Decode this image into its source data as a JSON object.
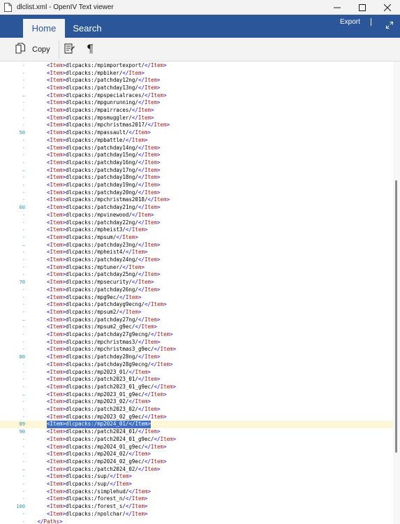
{
  "window": {
    "title": "dlclist.xml - OpenIV Text viewer"
  },
  "ribbon": {
    "tabs": [
      {
        "label": "Home"
      },
      {
        "label": "Search"
      }
    ],
    "export_label": "Export"
  },
  "toolbar": {
    "copy_label": "Copy"
  },
  "icons": {
    "app": "document-icon",
    "minimize": "minimize-icon",
    "maximize": "maximize-icon",
    "close": "close-icon",
    "expand": "expand-icon",
    "copy": "copy-icon",
    "word_wrap": "word-wrap-icon",
    "show_symbols": "pilcrow-icon"
  },
  "colors": {
    "accent": "#2b579a",
    "tag": "#0000ff",
    "tag_name": "#a31515",
    "line_number": "#2b91af",
    "selection": "#3e6fc5",
    "current_line": "#fdf7d8"
  },
  "editor": {
    "highlighted_line": "89",
    "scroll_fraction": 0.55,
    "lines": [
      {
        "num": "·",
        "indent": "      ",
        "open": "Item",
        "text": "dlcpacks:/mpimportexport/",
        "close": "Item"
      },
      {
        "num": "·",
        "indent": "      ",
        "open": "Item",
        "text": "dlcpacks:/mpbiker/",
        "close": "Item"
      },
      {
        "num": "·",
        "indent": "      ",
        "open": "Item",
        "text": "dlcpacks:/patchday12ng/",
        "close": "Item"
      },
      {
        "num": "·",
        "indent": "      ",
        "open": "Item",
        "text": "dlcpacks:/patchday13ng/",
        "close": "Item"
      },
      {
        "num": "–",
        "indent": "      ",
        "open": "Item",
        "text": "dlcpacks:/mpspecialraces/",
        "close": "Item"
      },
      {
        "num": "·",
        "indent": "      ",
        "open": "Item",
        "text": "dlcpacks:/mpgunrunning/",
        "close": "Item"
      },
      {
        "num": "·",
        "indent": "      ",
        "open": "Item",
        "text": "dlcpacks:/mpairraces/",
        "close": "Item"
      },
      {
        "num": "·",
        "indent": "      ",
        "open": "Item",
        "text": "dlcpacks:/mpsmuggler/",
        "close": "Item"
      },
      {
        "num": "·",
        "indent": "      ",
        "open": "Item",
        "text": "dlcpacks:/mpchristmas2017/",
        "close": "Item"
      },
      {
        "num": "50",
        "indent": "      ",
        "open": "Item",
        "text": "dlcpacks:/mpassault/",
        "close": "Item"
      },
      {
        "num": "·",
        "indent": "      ",
        "open": "Item",
        "text": "dlcpacks:/mpbattle/",
        "close": "Item"
      },
      {
        "num": "·",
        "indent": "      ",
        "open": "Item",
        "text": "dlcpacks:/patchday14ng/",
        "close": "Item"
      },
      {
        "num": "·",
        "indent": "      ",
        "open": "Item",
        "text": "dlcpacks:/patchday15ng/",
        "close": "Item"
      },
      {
        "num": "·",
        "indent": "      ",
        "open": "Item",
        "text": "dlcpacks:/patchday16ng/",
        "close": "Item"
      },
      {
        "num": "–",
        "indent": "      ",
        "open": "Item",
        "text": "dlcpacks:/patchday17ng/",
        "close": "Item"
      },
      {
        "num": "·",
        "indent": "      ",
        "open": "Item",
        "text": "dlcpacks:/patchday18ng/",
        "close": "Item"
      },
      {
        "num": "·",
        "indent": "      ",
        "open": "Item",
        "text": "dlcpacks:/patchday19ng/",
        "close": "Item"
      },
      {
        "num": "·",
        "indent": "      ",
        "open": "Item",
        "text": "dlcpacks:/patchday20ng/",
        "close": "Item"
      },
      {
        "num": "·",
        "indent": "      ",
        "open": "Item",
        "text": "dlcpacks:/mpchristmas2018/",
        "close": "Item"
      },
      {
        "num": "60",
        "indent": "      ",
        "open": "Item",
        "text": "dlcpacks:/patchday21ng/",
        "close": "Item"
      },
      {
        "num": "·",
        "indent": "      ",
        "open": "Item",
        "text": "dlcpacks:/mpvinewood/",
        "close": "Item"
      },
      {
        "num": "·",
        "indent": "      ",
        "open": "Item",
        "text": "dlcpacks:/patchday22ng/",
        "close": "Item"
      },
      {
        "num": "·",
        "indent": "      ",
        "open": "Item",
        "text": "dlcpacks:/mpheist3/",
        "close": "Item"
      },
      {
        "num": "·",
        "indent": "      ",
        "open": "Item",
        "text": "dlcpacks:/mpsum/",
        "close": "Item"
      },
      {
        "num": "–",
        "indent": "      ",
        "open": "Item",
        "text": "dlcpacks:/patchday23ng/",
        "close": "Item"
      },
      {
        "num": "·",
        "indent": "      ",
        "open": "Item",
        "text": "dlcpacks:/mpheist4/",
        "close": "Item"
      },
      {
        "num": "·",
        "indent": "      ",
        "open": "Item",
        "text": "dlcpacks:/patchday24ng/",
        "close": "Item"
      },
      {
        "num": "·",
        "indent": "      ",
        "open": "Item",
        "text": "dlcpacks:/mptuner/",
        "close": "Item"
      },
      {
        "num": "·",
        "indent": "      ",
        "open": "Item",
        "text": "dlcpacks:/patchday25ng/",
        "close": "Item"
      },
      {
        "num": "70",
        "indent": "      ",
        "open": "Item",
        "text": "dlcpacks:/mpsecurity/",
        "close": "Item"
      },
      {
        "num": "·",
        "indent": "      ",
        "open": "Item",
        "text": "dlcpacks:/patchday26ng/",
        "close": "Item"
      },
      {
        "num": "·",
        "indent": "      ",
        "open": "Item",
        "text": "dlcpacks:/mpg9ec/",
        "close": "Item"
      },
      {
        "num": "·",
        "indent": "      ",
        "open": "Item",
        "text": "dlcpacks:/patchdayg9ecng/",
        "close": "Item"
      },
      {
        "num": "·",
        "indent": "      ",
        "open": "Item",
        "text": "dlcpacks:/mpsum2/",
        "close": "Item"
      },
      {
        "num": "–",
        "indent": "      ",
        "open": "Item",
        "text": "dlcpacks:/patchday27ng/",
        "close": "Item"
      },
      {
        "num": "·",
        "indent": "      ",
        "open": "Item",
        "text": "dlcpacks:/mpsum2_g9ec/",
        "close": "Item"
      },
      {
        "num": "·",
        "indent": "      ",
        "open": "Item",
        "text": "dlcpacks:/patchday27g9ecng/",
        "close": "Item"
      },
      {
        "num": "·",
        "indent": "      ",
        "open": "Item",
        "text": "dlcpacks:/mpchristmas3/",
        "close": "Item"
      },
      {
        "num": "·",
        "indent": "      ",
        "open": "Item",
        "text": "dlcpacks:/mpchristmas3_g9ec/",
        "close": "Item"
      },
      {
        "num": "80",
        "indent": "      ",
        "open": "Item",
        "text": "dlcpacks:/patchday28ng/",
        "close": "Item"
      },
      {
        "num": "·",
        "indent": "      ",
        "open": "Item",
        "text": "dlcpacks:/patchday28g9ecng/",
        "close": "Item"
      },
      {
        "num": "·",
        "indent": "      ",
        "open": "Item",
        "text": "dlcpacks:/mp2023_01/",
        "close": "Item"
      },
      {
        "num": "·",
        "indent": "      ",
        "open": "Item",
        "text": "dlcpacks:/patch2023_01/",
        "close": "Item"
      },
      {
        "num": "·",
        "indent": "      ",
        "open": "Item",
        "text": "dlcpacks:/patch2023_01_g9ec/",
        "close": "Item"
      },
      {
        "num": "–",
        "indent": "      ",
        "open": "Item",
        "text": "dlcpacks:/mp2023_01_g9ec/",
        "close": "Item"
      },
      {
        "num": "·",
        "indent": "      ",
        "open": "Item",
        "text": "dlcpacks:/mp2023_02/",
        "close": "Item"
      },
      {
        "num": "·",
        "indent": "      ",
        "open": "Item",
        "text": "dlcpacks:/patch2023_02/",
        "close": "Item"
      },
      {
        "num": "·",
        "indent": "      ",
        "open": "Item",
        "text": "dlcpacks:/mp2023_02_g9ec/",
        "close": "Item"
      },
      {
        "num": "89",
        "indent": "      ",
        "open": "Item",
        "text": "dlcpacks:/mp2024_01/",
        "close": "Item"
      },
      {
        "num": "90",
        "indent": "      ",
        "open": "Item",
        "text": "dlcpacks:/patch2024_01/",
        "close": "Item"
      },
      {
        "num": "·",
        "indent": "      ",
        "open": "Item",
        "text": "dlcpacks:/patch2024_01_g9ec/",
        "close": "Item"
      },
      {
        "num": "·",
        "indent": "      ",
        "open": "Item",
        "text": "dlcpacks:/mp2024_01_g9ec/",
        "close": "Item"
      },
      {
        "num": "·",
        "indent": "      ",
        "open": "Item",
        "text": "dlcpacks:/mp2024_02/",
        "close": "Item"
      },
      {
        "num": "·",
        "indent": "      ",
        "open": "Item",
        "text": "dlcpacks:/mp2024_02_g9ec/",
        "close": "Item"
      },
      {
        "num": "–",
        "indent": "      ",
        "open": "Item",
        "text": "dlcpacks:/patch2024_02/",
        "close": "Item"
      },
      {
        "num": "·",
        "indent": "      ",
        "open": "Item",
        "text": "dlcpacks:/sup/",
        "close": "Item"
      },
      {
        "num": "·",
        "indent": "      ",
        "open": "Item",
        "text": "dlcpacks:/sup/",
        "close": "Item"
      },
      {
        "num": "·",
        "indent": "      ",
        "open": "Item",
        "text": "dlcpacks:/simplehud/",
        "close": "Item"
      },
      {
        "num": "·",
        "indent": "      ",
        "open": "Item",
        "text": "dlcpacks:/forest_n/",
        "close": "Item"
      },
      {
        "num": "100",
        "indent": "      ",
        "open": "Item",
        "text": "dlcpacks:/forest_s/",
        "close": "Item"
      },
      {
        "num": "·",
        "indent": "      ",
        "open": "Item",
        "text": "dlcpacks:/npolchar/",
        "close": "Item"
      },
      {
        "num": "·",
        "indent": "   ",
        "open": "",
        "text": "",
        "close": "Paths"
      }
    ]
  }
}
